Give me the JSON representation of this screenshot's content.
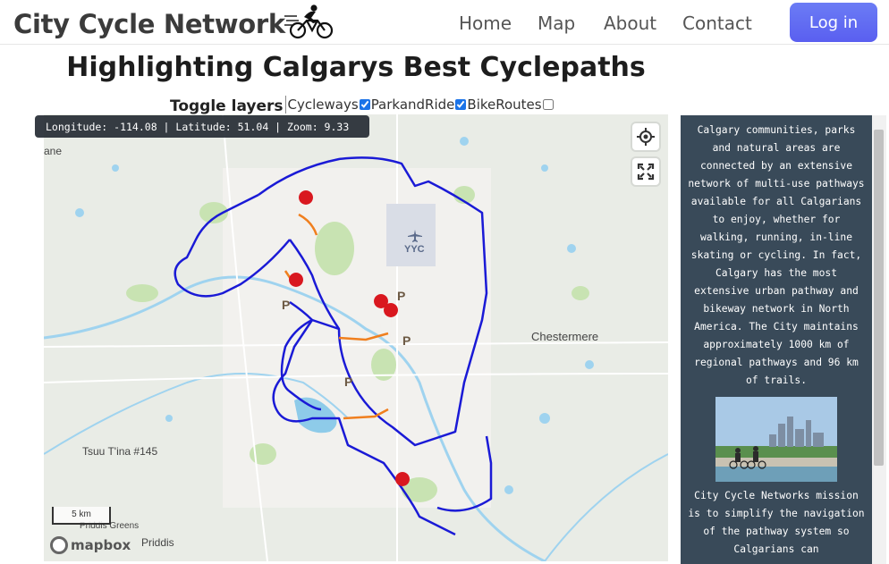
{
  "nav": {
    "brand": "City Cycle Network",
    "brand_icon": "cyclist-icon",
    "links": [
      "Home",
      "Map",
      "About",
      "Contact"
    ],
    "login_label": "Log in",
    "login_color": "#5f63f0"
  },
  "page": {
    "title": "Highlighting Calgarys Best Cyclepaths"
  },
  "toggles": {
    "title": "Toggle layers",
    "layers": [
      {
        "label": "Cycleways",
        "checked": true
      },
      {
        "label": "ParkandRide",
        "checked": true
      },
      {
        "label": "BikeRoutes",
        "checked": false
      }
    ]
  },
  "map": {
    "coord_readout": "Longitude: -114.08 | Latitude: 51.04 | Zoom: 9.33",
    "scale_label": "5 km",
    "attribution": "mapbox",
    "places": [
      "ane",
      "Chestermere",
      "Tsuu T'ina #145",
      "Priddis Greens",
      "Priddis",
      "YYC"
    ],
    "colors": {
      "cycleway": "#1a1ad6",
      "route": "#f07f1e",
      "marker": "#d9181f",
      "parking": "#6d5a44"
    },
    "controls": [
      "geolocate-icon",
      "fullscreen-icon"
    ]
  },
  "sidebar": {
    "intro": "Calgary communities, parks and natural areas are connected by an extensive network of multi-use pathways available for all Calgarians to enjoy, whether for walking, running, in-line skating or cycling. In fact, Calgary has the most extensive urban pathway and bikeway network in North America. The City maintains approximately 1000 km of regional pathways and 96 km of trails.",
    "mission": "City Cycle Networks mission is to simplify the navigation of the pathway system so Calgarians can",
    "background": "#394a59"
  }
}
